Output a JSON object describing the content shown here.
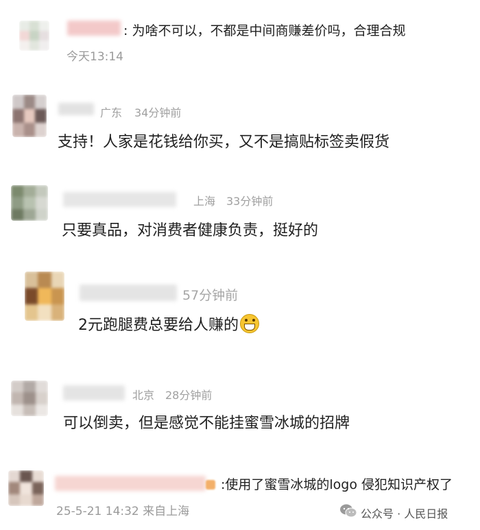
{
  "comments": [
    {
      "region": "",
      "time": "今天13:14",
      "text": ": 为啥不可以，不都是中间商赚差价吗，合理合规"
    },
    {
      "region": "广东",
      "time": "34分钟前",
      "text": "支持！人家是花钱给你买，又不是搞贴标签卖假货"
    },
    {
      "region": "上海",
      "time": "33分钟前",
      "text": "只要真品，对消费者健康负责，挺好的"
    },
    {
      "region": "",
      "time": "57分钟前",
      "text": "2元跑腿费总要给人赚的"
    },
    {
      "region": "北京",
      "time": "28分钟前",
      "text": "可以倒卖，但是感觉不能挂蜜雪冰城的招牌"
    },
    {
      "region": "",
      "time": "25-5-21 14:32 来自上海",
      "text": ":使用了蜜雪冰城的logo 侵犯知识产权了"
    }
  ],
  "emoji": "grinning-face-icon",
  "watermark": {
    "label": "公众号 · 人民日报",
    "icon": "wechat-icon"
  },
  "colors": {
    "meta": "#a0a0a0",
    "text": "#1f1f1f",
    "blurred_name": "#f3c9c9"
  }
}
